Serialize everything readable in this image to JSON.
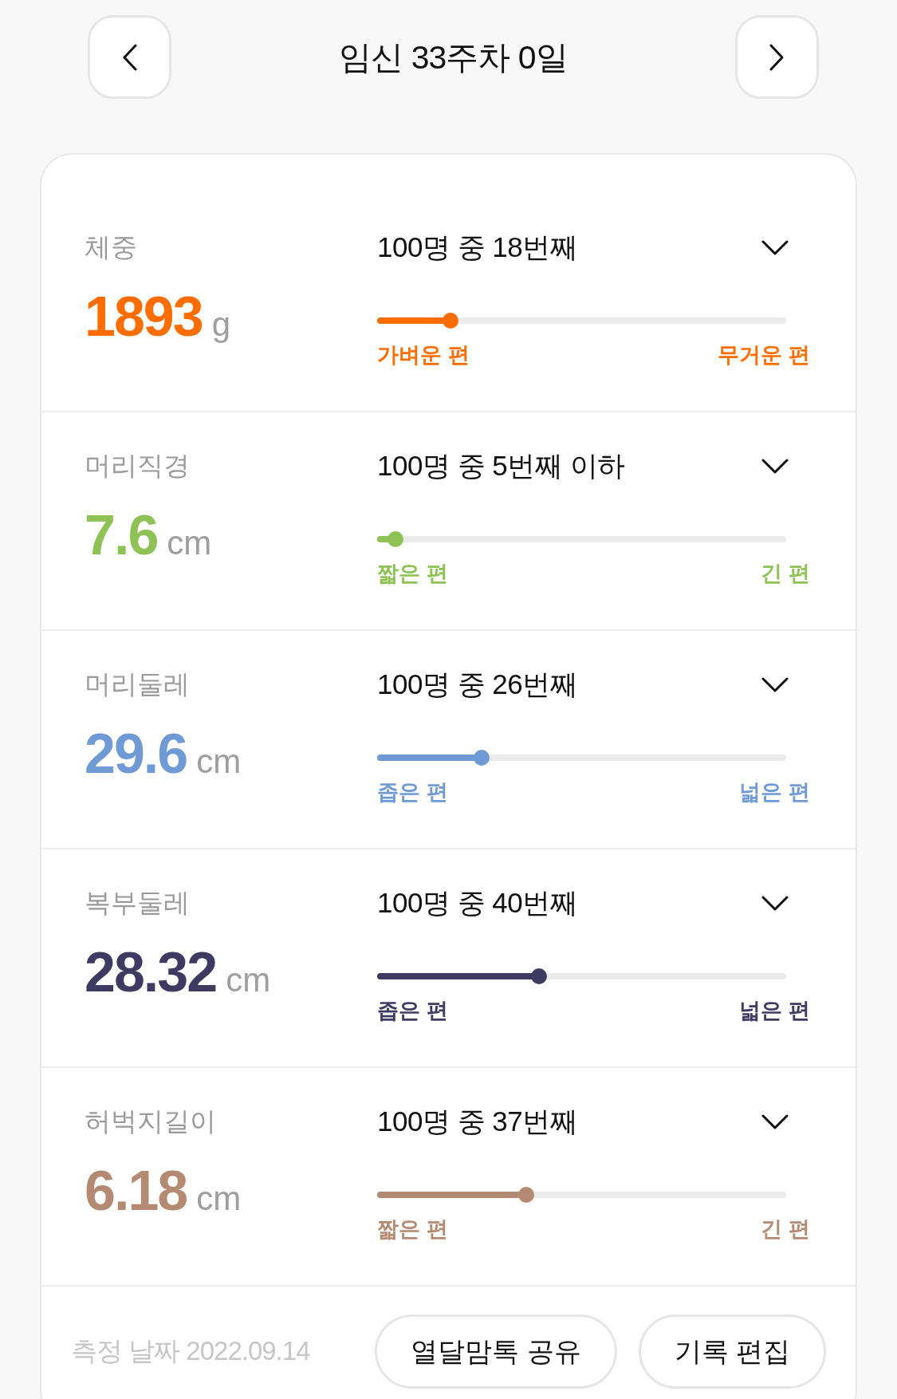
{
  "header": {
    "title": "임신 33주차 0일"
  },
  "metrics": [
    {
      "label": "체중",
      "value": "1893",
      "unit": "g",
      "rank": "100명 중 18번째",
      "level": 0.18,
      "color": "#ff6d00",
      "low_label": "가벼운 편",
      "high_label": "무거운 편",
      "expanded": false
    },
    {
      "label": "머리직경",
      "value": "7.6",
      "unit": "cm",
      "rank": "100명 중 5번째 이하",
      "level": 0.045,
      "color": "#8fc255",
      "low_label": "짧은 편",
      "high_label": "긴 편",
      "expanded": false
    },
    {
      "label": "머리둘레",
      "value": "29.6",
      "unit": "cm",
      "rank": "100명 중 26번째",
      "level": 0.255,
      "color": "#6f9ad6",
      "low_label": "좁은 편",
      "high_label": "넓은 편",
      "expanded": false
    },
    {
      "label": "복부둘레",
      "value": "28.32",
      "unit": "cm",
      "rank": "100명 중 40번째",
      "level": 0.395,
      "color": "#3f3a62",
      "low_label": "좁은 편",
      "high_label": "넓은 편",
      "expanded": false
    },
    {
      "label": "허벅지길이",
      "value": "6.18",
      "unit": "cm",
      "rank": "100명 중 37번째",
      "level": 0.365,
      "color": "#b48b72",
      "low_label": "짧은 편",
      "high_label": "긴 편",
      "expanded": false
    }
  ],
  "footer": {
    "date": "측정 날짜 2022.09.14",
    "buttons": [
      "열달맘톡 공유",
      "기록 편집"
    ]
  }
}
